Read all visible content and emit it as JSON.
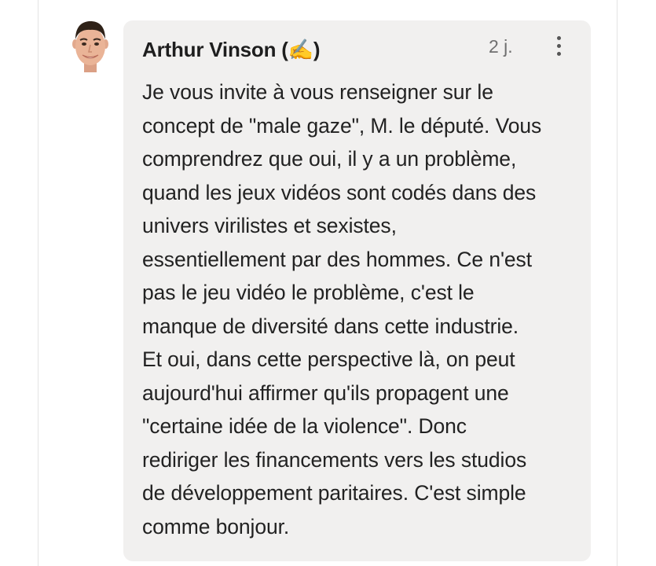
{
  "comment": {
    "author": "Arthur Vinson (✍️)",
    "timestamp": "2 j.",
    "lines": [
      "Je vous invite à vous renseigner sur le",
      "concept de \"male gaze\", M. le député. Vous",
      "comprendrez que oui, il y a un problème,",
      "quand les jeux vidéos sont codés dans des",
      "univers virilistes et sexistes,",
      "essentiellement par des hommes. Ce n'est",
      "pas le jeu vidéo le problème, c'est le",
      "manque de diversité dans cette industrie.",
      "Et oui, dans cette perspective là, on peut",
      "aujourd'hui affirmer qu'ils propagent une",
      "\"certaine idée de la violence\". Donc",
      "rediriger les financements vers les studios",
      "de développement paritaires. C'est simple",
      "comme bonjour."
    ]
  },
  "icons": {
    "avatar": "user-avatar-photo",
    "more": "more-vertical-icon"
  },
  "colors": {
    "bubble_background": "#f1f0ef",
    "author_text": "#1e1e1e",
    "body_text": "#222222",
    "timestamp_text": "#6f6f6f"
  }
}
